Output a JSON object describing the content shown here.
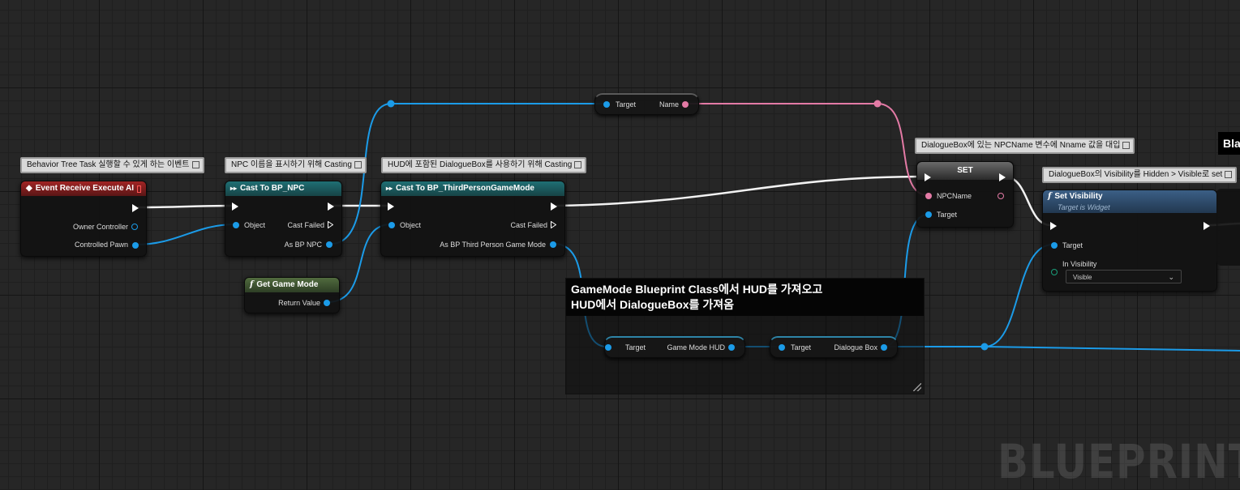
{
  "comments": {
    "event": "Behavior Tree Task 실행할 수 있게 하는 이벤트",
    "cast_npc": "NPC 이름을 표시하기 위해 Casting",
    "cast_gm": "HUD에 포함된 DialogueBox를 사용하기 위해 Casting",
    "set": "DialogueBox에 있는 NPCName 변수에 Nname 값을 대입",
    "visibility": "DialogueBox의 Visibility를 Hidden > Visible로 set",
    "group_line1": "GameMode Blueprint Class에서 HUD를 가져오고",
    "group_line2": "HUD에서 DialogueBox를 가져옴",
    "cutoff": "Bla"
  },
  "nodes": {
    "event": {
      "title": "Event Receive Execute AI",
      "owner": "Owner Controller",
      "pawn": "Controlled Pawn"
    },
    "cast_npc": {
      "title": "Cast To BP_NPC",
      "object": "Object",
      "failed": "Cast Failed",
      "as": "As BP NPC"
    },
    "get_gm": {
      "title": "Get Game Mode",
      "ret": "Return Value"
    },
    "cast_gm": {
      "title": "Cast To BP_ThirdPersonGameMode",
      "object": "Object",
      "failed": "Cast Failed",
      "as": "As BP Third Person Game Mode"
    },
    "get_name": {
      "target": "Target",
      "out": "Name"
    },
    "set": {
      "title": "SET",
      "npcname": "NPCName",
      "target": "Target"
    },
    "set_vis": {
      "title": "Set Visibility",
      "subtitle": "Target is Widget",
      "target": "Target",
      "in_vis": "In Visibility",
      "value": "Visible"
    },
    "get_hud": {
      "target": "Target",
      "out": "Game Mode HUD"
    },
    "get_box": {
      "target": "Target",
      "out": "Dialogue Box"
    }
  },
  "watermark": "BLUEPRINT",
  "colors": {
    "exec": "#ffffff",
    "object": "#1b9be8",
    "string": "#e37aa5",
    "event_header": "#a12424",
    "cast_header": "#1f6f74"
  },
  "icons": {
    "event": "event-diamond-icon",
    "cast": "cast-arrows-icon",
    "function": "function-f-icon",
    "dropdown": "chevron-down-icon"
  }
}
